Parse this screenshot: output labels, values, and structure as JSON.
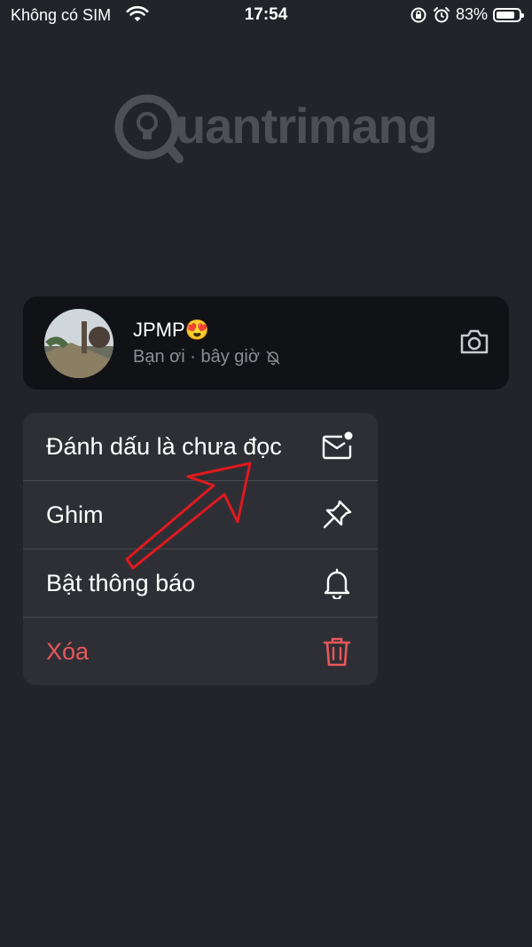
{
  "status_bar": {
    "carrier": "Không có SIM",
    "time": "17:54",
    "battery": "83%",
    "battery_level": 0.83,
    "icons": [
      "wifi-icon",
      "orientation-lock-icon",
      "alarm-icon",
      "battery-icon"
    ]
  },
  "watermark": {
    "text": "uantrimang"
  },
  "chat": {
    "name": "JPMP",
    "emoji": "😍",
    "preview": "Bạn ơi · bây giờ",
    "icons": [
      "avatar",
      "muted-bell-icon",
      "camera-icon"
    ]
  },
  "menu": {
    "items": [
      {
        "label": "Đánh dấu là chưa đọc",
        "icon": "mail-unread-icon"
      },
      {
        "label": "Ghim",
        "icon": "pin-icon"
      },
      {
        "label": "Bật thông báo",
        "icon": "bell-icon"
      },
      {
        "label": "Xóa",
        "icon": "trash-icon",
        "color": "#e8585a"
      }
    ]
  },
  "colors": {
    "background": "#23242a",
    "menu": "#2e2f35",
    "card": "#111216",
    "danger": "#e8585a",
    "annotation_arrow": "#e0191e"
  }
}
